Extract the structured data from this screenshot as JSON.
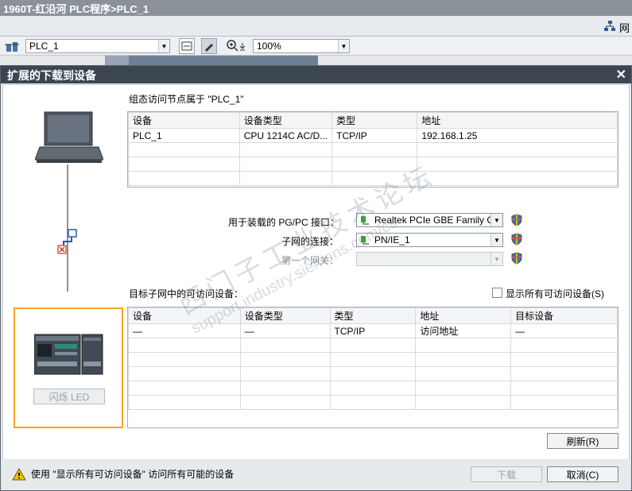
{
  "app": {
    "title": "1960T-红沿河 PLC程序>PLC_1",
    "right_label": "网",
    "device_combo": "PLC_1",
    "zoom_combo": "100%"
  },
  "dialog": {
    "title": "扩展的下载到设备",
    "close": "✕",
    "config_header": "组态访问节点属于 \"PLC_1\"",
    "config_table": {
      "columns": [
        "设备",
        "设备类型",
        "类型",
        "地址"
      ],
      "rows": [
        [
          "PLC_1",
          "CPU 1214C AC/D...",
          "TCP/IP",
          "192.168.1.25"
        ]
      ]
    },
    "iface": {
      "pgpc_label": "用于装载的 PG/PC 接口：",
      "pgpc_value": "Realtek PCIe GBE Family Con",
      "subnet_label": "子网的连接：",
      "subnet_value": "PN/IE_1",
      "gateway_label": "第一个网关：",
      "gateway_value": ""
    },
    "target_header": "目标子网中的可访问设备：",
    "show_all_label": "显示所有可访问设备(S)",
    "target_table": {
      "columns": [
        "设备",
        "设备类型",
        "类型",
        "地址",
        "目标设备"
      ],
      "rows": [
        [
          "—",
          "—",
          "TCP/IP",
          "访问地址",
          "—"
        ]
      ]
    },
    "flash_led": "闪烁 LED",
    "refresh": "刷新(R)",
    "status_text": "使用 \"显示所有可访问设备\" 访问所有可能的设备",
    "download": "下载",
    "cancel": "取消(C)"
  },
  "watermark": {
    "line1": "西门子工业技术论坛",
    "line2": "support.industry.siemens.com/cs"
  },
  "colors": {
    "title_bar": "#3c4650",
    "highlight_border": "#f5a623",
    "nic_green": "#3aa635"
  }
}
